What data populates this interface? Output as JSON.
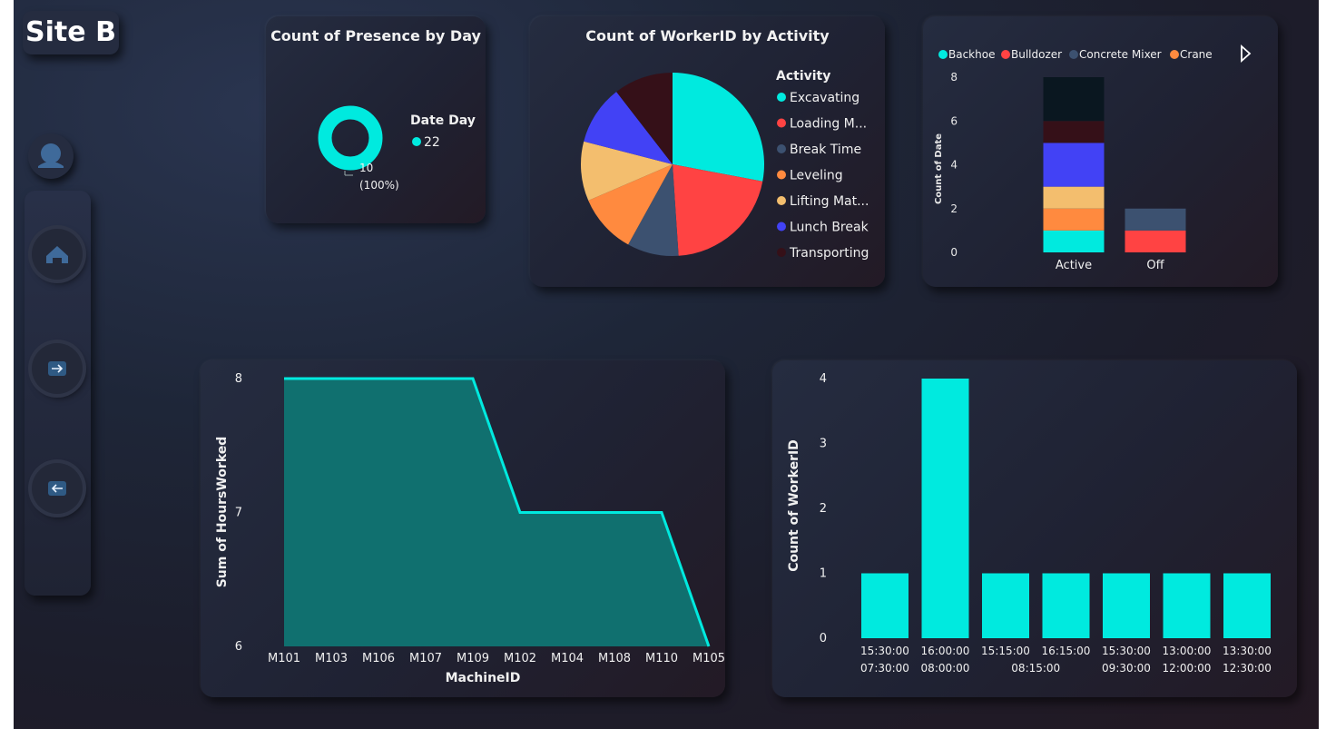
{
  "page": {
    "title": "Site B"
  },
  "colors": {
    "teal": "#00EADF",
    "red": "#FF4343",
    "slate": "#3C5170",
    "orange": "#FF8A3F",
    "sand": "#F3BE6E",
    "blue": "#4242F5",
    "maroon": "#351018",
    "dark": "#0A1720"
  },
  "nav": {
    "avatar_icon": "user-avatar-icon",
    "buttons": [
      {
        "icon": "home-icon"
      },
      {
        "icon": "arrow-right-icon"
      },
      {
        "icon": "arrow-left-icon"
      }
    ]
  },
  "chart_data": [
    {
      "type": "pie",
      "variant": "donut",
      "title": "Count of Presence by Day",
      "legend_title": "Date Day",
      "legend": [
        "22"
      ],
      "slices": [
        {
          "label": "22",
          "value": 10,
          "percent": "100%"
        }
      ],
      "data_label": "10",
      "data_label_pct": "(100%)"
    },
    {
      "type": "pie",
      "title": "Count of WorkerID by Activity",
      "legend_title": "Activity",
      "legend": [
        "Excavating",
        "Loading M...",
        "Break Time",
        "Leveling",
        "Lifting Mat...",
        "Lunch Break",
        "Transporting"
      ],
      "slices": [
        {
          "label": "Excavating",
          "value": 4
        },
        {
          "label": "Loading Materials",
          "value": 3
        },
        {
          "label": "Break Time",
          "value": 1.3
        },
        {
          "label": "Leveling",
          "value": 1.5
        },
        {
          "label": "Lifting Materials",
          "value": 1.5
        },
        {
          "label": "Lunch Break",
          "value": 1.5
        },
        {
          "label": "Transporting",
          "value": 1.5
        }
      ]
    },
    {
      "type": "bar",
      "stacked": true,
      "title": "",
      "ylabel": "Count of Date",
      "ylim": [
        0,
        8
      ],
      "yticks": [
        "0",
        "2",
        "4",
        "6",
        "8"
      ],
      "categories": [
        "Active",
        "Off"
      ],
      "legend": [
        "Backhoe",
        "Bulldozer",
        "Concrete Mixer",
        "Crane"
      ],
      "series": [
        {
          "name": "Backhoe",
          "values": [
            1,
            0
          ]
        },
        {
          "name": "Bulldozer",
          "values": [
            0,
            1
          ]
        },
        {
          "name": "Concrete Mixer",
          "values": [
            0,
            1
          ]
        },
        {
          "name": "Crane",
          "values": [
            1,
            0
          ]
        },
        {
          "values": [
            1,
            0
          ]
        },
        {
          "values": [
            2,
            0
          ]
        },
        {
          "values": [
            1,
            0
          ]
        },
        {
          "values": [
            2,
            0
          ]
        }
      ]
    },
    {
      "type": "area",
      "title": "",
      "xlabel": "MachineID",
      "ylabel": "Sum of HoursWorked",
      "ylim": [
        6,
        8
      ],
      "yticks": [
        "6",
        "7",
        "8"
      ],
      "categories": [
        "M101",
        "M103",
        "M106",
        "M107",
        "M109",
        "M102",
        "M104",
        "M108",
        "M110",
        "M105"
      ],
      "values": [
        8,
        8,
        8,
        8,
        8,
        7,
        7,
        7,
        7,
        6
      ]
    },
    {
      "type": "bar",
      "title": "",
      "ylabel": "Count of WorkerID",
      "ylim": [
        0,
        4
      ],
      "yticks": [
        "0",
        "1",
        "2",
        "3",
        "4"
      ],
      "categories": [
        "15:30:00",
        "16:00:00",
        "15:15:00",
        "16:15:00",
        "15:30:00",
        "13:00:00",
        "13:30:00"
      ],
      "group_labels": [
        "07:30:00",
        "08:00:00",
        "08:15:00",
        "09:30:00",
        "12:00:00",
        "12:30:00"
      ],
      "values": [
        1,
        4,
        1,
        1,
        1,
        1,
        1
      ]
    }
  ]
}
